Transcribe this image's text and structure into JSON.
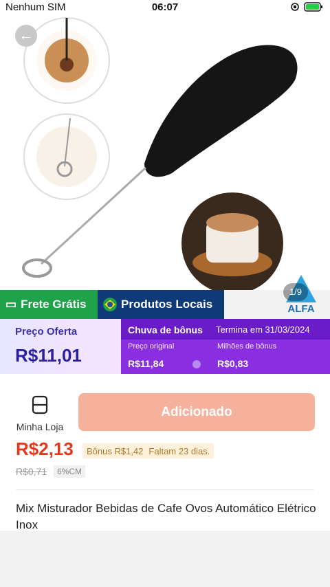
{
  "status": {
    "carrier": "Nenhum SIM",
    "time": "06:07"
  },
  "gallery": {
    "counter": "1/9",
    "brand": "ALFA"
  },
  "badges": {
    "shipping": "Frete Grátis",
    "local": "Produtos Locais"
  },
  "promo": {
    "offer_label": "Preço Oferta",
    "offer_price": "R$11,01",
    "bonus_title": "Chuva de bônus",
    "ends": "Termina em 31/03/2024",
    "original_label": "Preço original",
    "original_value": "R$11,84",
    "bonus_label": "Milhões de bônus",
    "bonus_value": "R$0,83"
  },
  "buy": {
    "store_label": "Minha Loja",
    "add_label": "Adicionado",
    "price": "R$2,13",
    "bonus": "Bônus R$1,42",
    "remaining": "Faltam 23 dias.",
    "old_price": "R$0,71",
    "discount": "6%CM"
  },
  "product": {
    "title": "Mix Misturador Bebidas de Cafe Ovos Automático Elétrico Inox"
  }
}
